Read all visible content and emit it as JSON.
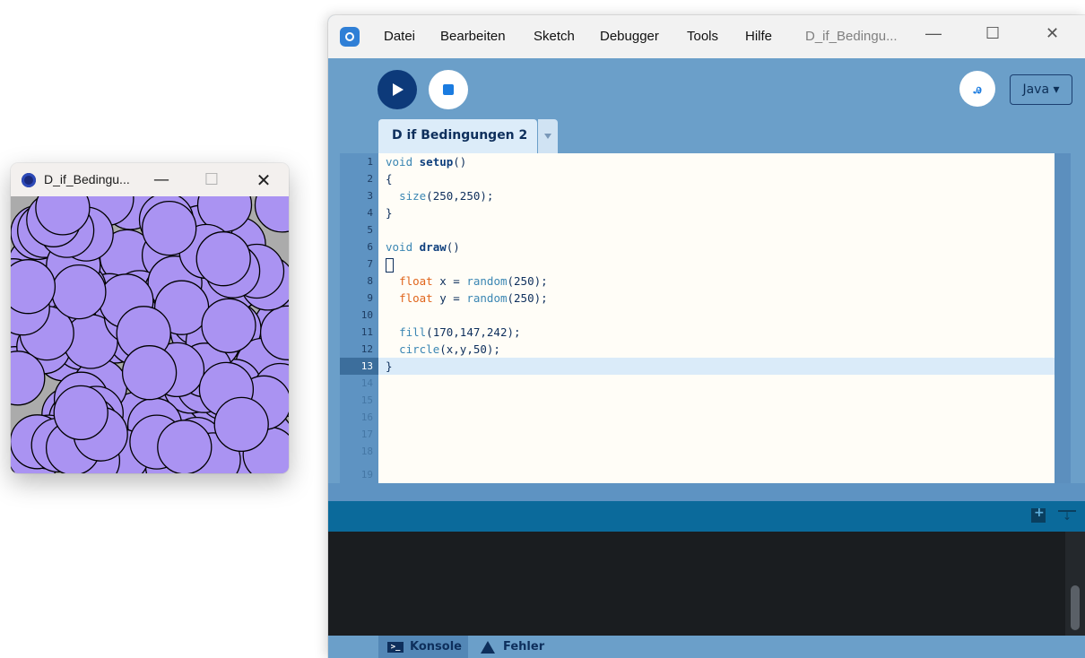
{
  "sketch_window": {
    "title": "D_if_Bedingu...",
    "minimize_glyph": "—",
    "maximize_glyph": "☐",
    "close_glyph": "✕",
    "canvas": {
      "size": [
        250,
        250
      ],
      "circle_fill": "#aa93f2",
      "circle_stroke": "#000000",
      "circle_diameter": 50,
      "background": "#ababab"
    }
  },
  "ide": {
    "menu": [
      "Datei",
      "Bearbeiten",
      "Sketch",
      "Debugger",
      "Tools",
      "Hilfe"
    ],
    "window_title": "D_if_Bedingu...",
    "minimize_glyph": "—",
    "maximize_glyph": "☐",
    "close_glyph": "✕",
    "debug_label": "ꭿ",
    "mode_label": "Java ▾",
    "tab_label": "D if Bedingungen 2",
    "line_numbers": [
      "1",
      "2",
      "3",
      "4",
      "5",
      "6",
      "7",
      "8",
      "9",
      "10",
      "11",
      "12",
      "13",
      "14",
      "15",
      "16",
      "17",
      "18",
      "19"
    ],
    "current_line": 13,
    "code": {
      "l1_type": "void",
      "l1_fn": "setup",
      "l1_rest": "()",
      "l2": "{",
      "l3_call": "size",
      "l3_rest": "(250,250);",
      "l4": "}",
      "l6_type": "void",
      "l6_fn": "draw",
      "l6_rest": "()",
      "l7": "{",
      "l8_type": "float",
      "l8_mid": " x = ",
      "l8_call": "random",
      "l8_rest": "(250);",
      "l9_type": "float",
      "l9_mid": " y = ",
      "l9_call": "random",
      "l9_rest": "(250);",
      "l11_call": "fill",
      "l11_rest": "(170,147,242);",
      "l12_call": "circle",
      "l12_rest": "(x,y,50);",
      "l13": "}"
    },
    "status": {
      "console_label": "Konsole",
      "console_icon": "terminal-icon",
      "errors_label": "Fehler",
      "errors_icon": "warning-icon"
    },
    "colors": {
      "accent": "#1a7be0",
      "run_button": "#0d3a7a",
      "frame": "#6b9fc9",
      "console_bg": "#1a1d20"
    }
  }
}
